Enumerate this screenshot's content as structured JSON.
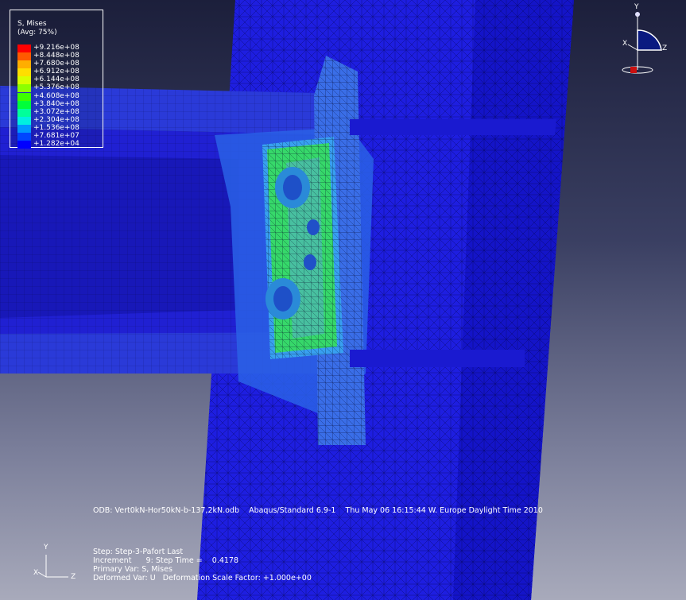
{
  "legend": {
    "title": "S, Mises",
    "subtitle": "(Avg: 75%)",
    "levels": [
      {
        "value": "+9.216e+08",
        "color": "#ff0000"
      },
      {
        "value": "+8.448e+08",
        "color": "#ff5a00"
      },
      {
        "value": "+7.680e+08",
        "color": "#ffae00"
      },
      {
        "value": "+6.912e+08",
        "color": "#ffde00"
      },
      {
        "value": "+6.144e+08",
        "color": "#d8ff00"
      },
      {
        "value": "+5.376e+08",
        "color": "#8cff00"
      },
      {
        "value": "+4.608e+08",
        "color": "#3cff00"
      },
      {
        "value": "+3.840e+08",
        "color": "#00ff3a"
      },
      {
        "value": "+3.072e+08",
        "color": "#00ff9a"
      },
      {
        "value": "+2.304e+08",
        "color": "#00f0e0"
      },
      {
        "value": "+1.536e+08",
        "color": "#0098ff"
      },
      {
        "value": "+7.681e+07",
        "color": "#0046ff"
      },
      {
        "value": "+1.282e+04",
        "color": "#0000ff"
      }
    ]
  },
  "odb_line": "ODB: Vert0kN-Hor50kN-b-137,2kN.odb    Abaqus/Standard 6.9-1    Thu May 06 16:15:44 W. Europe Daylight Time 2010",
  "step_info": {
    "step": "Step: Step-3-Pafort Last",
    "increment": "Increment      9: Step Time =    0.4178",
    "primary_var": "Primary Var: S, Mises",
    "deformed_var": "Deformed Var: U   Deformation Scale Factor: +1.000e+00"
  },
  "view_triad": {
    "y": "Y",
    "x": "X",
    "z": "Z"
  },
  "model_triad": {
    "y": "Y",
    "x": "X",
    "z": "Z"
  }
}
